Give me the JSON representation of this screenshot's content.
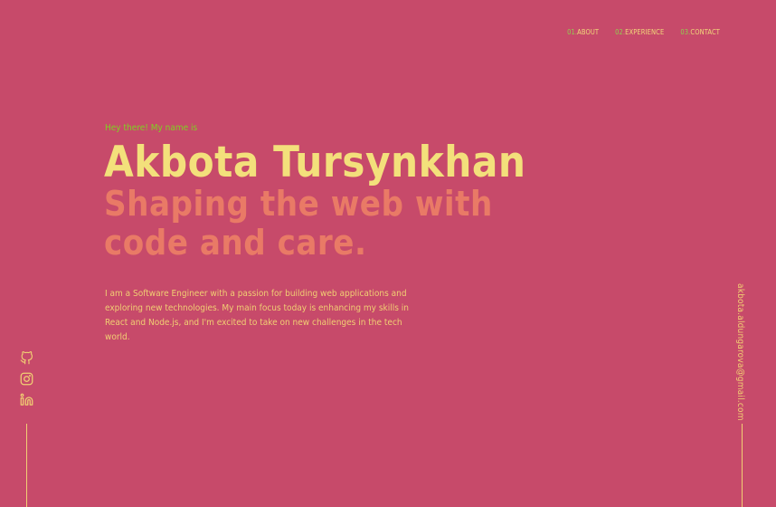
{
  "nav": [
    {
      "num": "01.",
      "label": "ABOUT"
    },
    {
      "num": "02.",
      "label": "EXPERIENCE"
    },
    {
      "num": "03.",
      "label": "CONTACT"
    }
  ],
  "hero": {
    "greeting": "Hey there! My name is",
    "name": "Akbota Tursynkhan",
    "tagline": "Shaping the web with code and care.",
    "bio": "I am a Software Engineer with a passion for building web applications and exploring new technologies. My main focus today is enhancing my skills in React and Node.js, and I'm excited to take on new challenges in the tech world."
  },
  "social": [
    {
      "icon": "github-icon"
    },
    {
      "icon": "instagram-icon"
    },
    {
      "icon": "linkedin-icon"
    }
  ],
  "email": "akbota.aldungarova@gmail.com",
  "colors": {
    "background": "#c74a6a",
    "name": "#f3e07b",
    "tagline": "#e97a66",
    "accent": "#7ed321",
    "text": "#f1cf73"
  }
}
